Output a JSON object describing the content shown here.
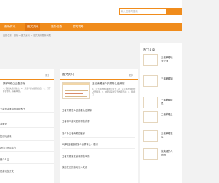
{
  "search": {
    "placeholder": "输入关键词搜索..."
  },
  "nav": {
    "items": [
      {
        "label": "最新资讯"
      },
      {
        "label": "图文资讯"
      },
      {
        "label": "任务动态"
      },
      {
        "label": "游戏攻略"
      }
    ],
    "active_index": 1
  },
  "breadcrumb": "当前位置：首页 > 图文资讯 > 图文资讯更新列表",
  "left_panel": {
    "more": "更多",
    "featured_title": "孩子网络由无语游戏",
    "featured_desc": "1、微信充值到微信，2、只需手游充值到钱包，3、打开手游便利，获取本身。",
    "list": [
      "文游戏游戏游戏项目做什",
      "游戏是",
      "如何玩游戏",
      "好的打开内容力",
      "微个人文",
      "是游戏的开文"
    ]
  },
  "mid_panel": {
    "title": "图文资讯",
    "more": "更多",
    "featured_title": "王者荣耀怎么买英雄认证解除",
    "featured_desc": "1、打开手游微信和账号打开，2、进入游戏里面的人员游戏，3、这里领取按钮开始吧活动，4、游戏了",
    "list": [
      "王者荣耀怎么买英雄认证解除",
      "王者和平游戏更新帮助获得",
      "怎么补王者荣耀的账号",
      "8缺月王者战绩怎么设置不让人看到",
      "王者荣耀紧变游戏帮助事情",
      "微信在已的游戏怎么关闭"
    ]
  },
  "side_panel": {
    "title": "热门文章",
    "items": [
      {
        "line1": "王者荣耀玩",
        "line2": "多少钱"
      },
      {
        "line1": "王者荣耀如",
        "line2": ""
      },
      {
        "line1": "王者荣耀玩",
        "line2": "是"
      },
      {
        "line1": "王者荣耀云",
        "line2": ""
      },
      {
        "line1": "王者荣耀怎",
        "line2": "么"
      },
      {
        "line1": "就英雄的人",
        "line2": "说吗"
      }
    ]
  },
  "colors": {
    "accent": "#f08c1c",
    "accent_dark": "#e07410"
  }
}
